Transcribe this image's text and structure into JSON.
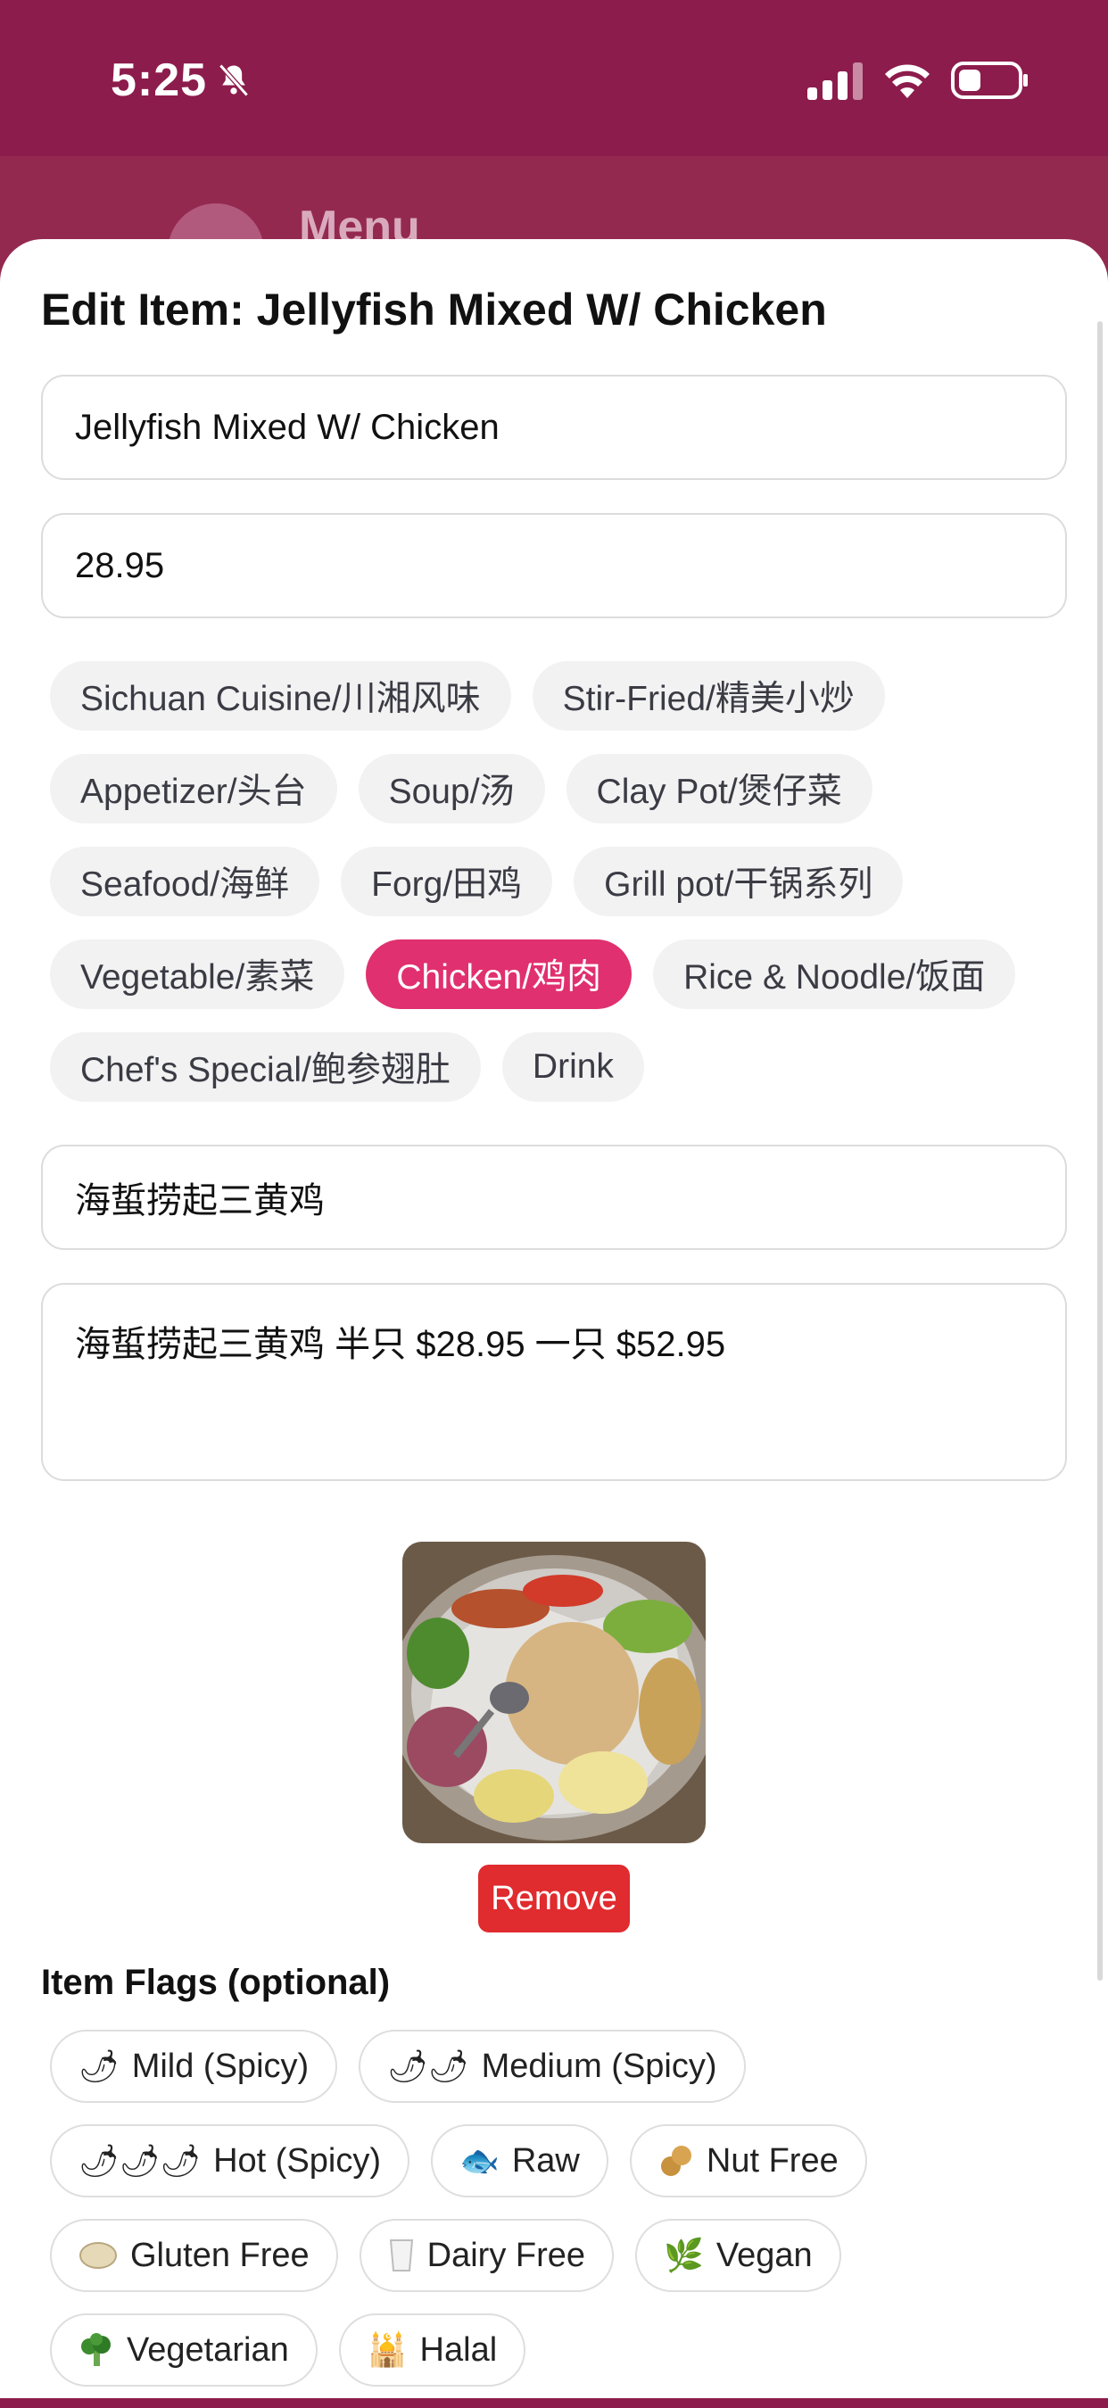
{
  "status_bar": {
    "time": "5:25"
  },
  "backdrop": {
    "title": "Menu"
  },
  "sheet": {
    "title": "Edit Item: Jellyfish Mixed W/ Chicken",
    "name_value": "Jellyfish Mixed W/ Chicken",
    "price_value": "28.95",
    "categories": [
      {
        "label": "Sichuan Cuisine/川湘风味",
        "selected": false
      },
      {
        "label": "Stir-Fried/精美小炒",
        "selected": false
      },
      {
        "label": "Appetizer/头台",
        "selected": false
      },
      {
        "label": "Soup/汤",
        "selected": false
      },
      {
        "label": "Clay Pot/煲仔菜",
        "selected": false
      },
      {
        "label": "Seafood/海鲜",
        "selected": false
      },
      {
        "label": "Forg/田鸡",
        "selected": false
      },
      {
        "label": "Grill pot/干锅系列",
        "selected": false
      },
      {
        "label": "Vegetable/素菜",
        "selected": false
      },
      {
        "label": "Chicken/鸡肉",
        "selected": true
      },
      {
        "label": "Rice & Noodle/饭面",
        "selected": false
      },
      {
        "label": "Chef's Special/鲍参翅肚",
        "selected": false
      },
      {
        "label": "Drink",
        "selected": false
      }
    ],
    "chinese_name_value": "海蜇捞起三黄鸡",
    "description_value": "海蜇捞起三黄鸡 半只 $28.95 一只 $52.95",
    "remove_label": "Remove",
    "flags_title": "Item Flags (optional)",
    "flags": [
      {
        "label": "Mild (Spicy)",
        "icon": "chili-pepper-icon"
      },
      {
        "label": "Medium (Spicy)",
        "icon": "chili-pepper-icon"
      },
      {
        "label": "Hot (Spicy)",
        "icon": "chili-pepper-icon"
      },
      {
        "label": "Raw",
        "icon": "fish-icon"
      },
      {
        "label": "Nut Free",
        "icon": "peanut-icon"
      },
      {
        "label": "Gluten Free",
        "icon": "flatbread-icon"
      },
      {
        "label": "Dairy Free",
        "icon": "milk-glass-icon"
      },
      {
        "label": "Vegan",
        "icon": "herb-icon"
      },
      {
        "label": "Vegetarian",
        "icon": "broccoli-icon"
      },
      {
        "label": "Halal",
        "icon": "mosque-icon"
      }
    ]
  },
  "colors": {
    "header_bg": "#8c1c4c",
    "accent": "#e0306f",
    "danger": "#e02b2f",
    "chip_bg": "#f2f2f3"
  }
}
